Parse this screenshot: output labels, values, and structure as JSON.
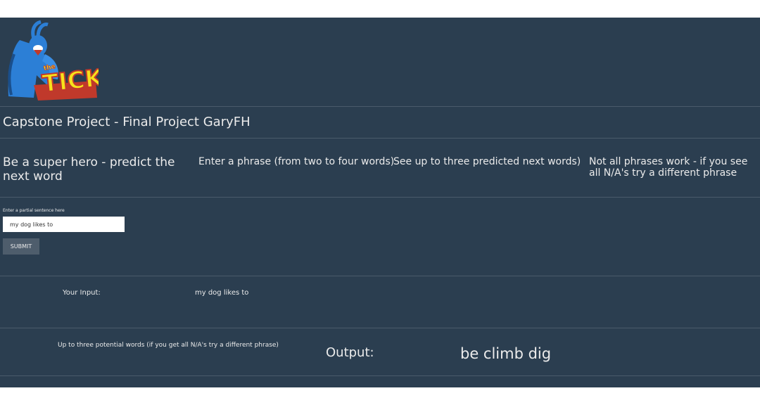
{
  "logo": {
    "text": "TICK",
    "prefix": "the"
  },
  "project_title": "Capstone Project - Final Project GaryFH",
  "intro": {
    "col1": "Be a super hero - predict the next word",
    "col2": "Enter a phrase (from two to four words)",
    "col3": "See up to three predicted next words)",
    "col4": "Not all phrases work - if you see all N/A's try a different phrase"
  },
  "form": {
    "input_label": "Enter a partial sentence here",
    "input_value": "my dog likes to",
    "submit_label": "SUBMIT"
  },
  "results": {
    "your_input_label": "Your Input:",
    "your_input_value": "my dog likes to",
    "potential_label": "Up to three potential words (if you get all N/A's try a different phrase)",
    "output_label": "Output:",
    "output_words": "be climb dig"
  },
  "colors": {
    "background": "#2b3e50",
    "text": "#ebebeb",
    "button": "#4e5d6c"
  }
}
